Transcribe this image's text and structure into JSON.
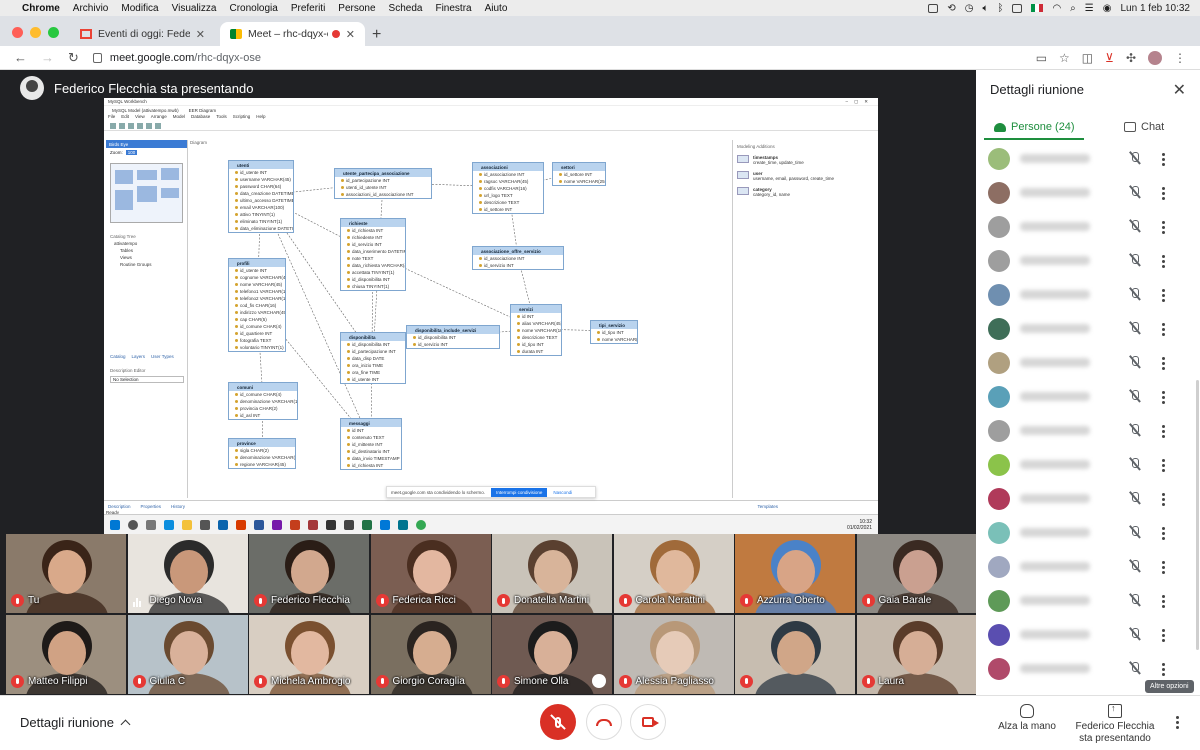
{
  "macos_menu": {
    "app": "Chrome",
    "items": [
      "Archivio",
      "Modifica",
      "Visualizza",
      "Cronologia",
      "Preferiti",
      "Persone",
      "Scheda",
      "Finestra",
      "Aiuto"
    ],
    "clock": "Lun 1 feb  10:32"
  },
  "browser": {
    "tabs": [
      {
        "title": "Eventi di oggi: Federico Flecchia"
      },
      {
        "title": "Meet – rhc-dqyx-ose"
      }
    ],
    "url_host": "meet.google.com",
    "url_path": "/rhc-dqyx-ose"
  },
  "stage": {
    "presenter_label": "Federico Flecchia sta presentando"
  },
  "workbench": {
    "title": "MySQL Workbench",
    "tabs": [
      "MySQL Model (attivatempo.mwb)",
      "EER Diagram"
    ],
    "menu": [
      "File",
      "Edit",
      "View",
      "Arrange",
      "Model",
      "Database",
      "Tools",
      "Scripting",
      "Help"
    ],
    "left_head": "Birds Eye",
    "zoom_label": "Zoom:",
    "zoom_value": "100",
    "catalog_label": "Catalog Tree",
    "tree": [
      "attivatempo",
      "Tables",
      "Views",
      "Routine Groups"
    ],
    "left_tabs": [
      "Catalog",
      "Layers",
      "User Types"
    ],
    "description_label": "Description Editor",
    "no_selection": "No Selection",
    "canvas_label": "Diagram",
    "right_head": "Modeling Additions",
    "additions": [
      {
        "name": "timestamps",
        "desc": "create_time, update_time"
      },
      {
        "name": "user",
        "desc": "username, email, password, create_time"
      },
      {
        "name": "category",
        "desc": "category_id, name"
      }
    ],
    "bottom_tabs": [
      "Description",
      "Properties",
      "History"
    ],
    "right_bottom_tab": "Templates",
    "status": "Ready",
    "taskbar_time": "10:32",
    "taskbar_date": "01/02/2021",
    "share_msg": "meet.google.com sta condividendo lo schermo.",
    "share_stop": "Interrompi condivisione",
    "share_hide": "Nascondi",
    "entities": [
      {
        "name": "utenti",
        "fields": [
          "id_utente INT",
          "username VARCHAR(45)",
          "password CHAR(64)",
          "data_creazione DATETIME",
          "ultimo_accesso DATETIME",
          "email VARCHAR(100)",
          "attivo TINYINT(1)",
          "eliminato TINYINT(1)",
          "data_eliminazione DATETIME"
        ]
      },
      {
        "name": "profili",
        "fields": [
          "id_utente INT",
          "cognome VARCHAR(45)",
          "nome VARCHAR(45)",
          "telefono1 VARCHAR(15)",
          "telefono2 VARCHAR(15)",
          "cod_fis CHAR(16)",
          "indirizzo VARCHAR(45)",
          "cap CHAR(5)",
          "id_comune CHAR(4)",
          "id_quartiere INT",
          "fotografia TEXT",
          "volontario TINYINT(1)"
        ]
      },
      {
        "name": "comuni",
        "fields": [
          "id_comune CHAR(4)",
          "denominazione VARCHAR(100)",
          "provincia CHAR(2)",
          "id_asl INT"
        ]
      },
      {
        "name": "province",
        "fields": [
          "sigla CHAR(2)",
          "denominazione VARCHAR(45)",
          "regione VARCHAR(45)"
        ]
      },
      {
        "name": "utente_partecipa_associazione",
        "fields": [
          "id_partecipazione INT",
          "utenti_id_utente INT",
          "associazioni_id_associazione INT"
        ]
      },
      {
        "name": "richieste",
        "fields": [
          "id_richiesta INT",
          "richiedente INT",
          "id_servizio INT",
          "data_inserimento DATETIME",
          "note TEXT",
          "data_richiesta VARCHAR(45)",
          "accettata TINYINT(1)",
          "id_disponibilita INT",
          "chiusa TINYINT(1)"
        ]
      },
      {
        "name": "disponibilita",
        "fields": [
          "id_disponibilita INT",
          "id_partecipazione INT",
          "data_disp DATE",
          "ora_inizio TIME",
          "ora_fine TIME",
          "id_utente INT"
        ]
      },
      {
        "name": "messaggi",
        "fields": [
          "id INT",
          "contenuto TEXT",
          "id_mittente INT",
          "id_destinatario INT",
          "data_invio TIMESTAMP",
          "id_richiesta INT"
        ]
      },
      {
        "name": "disponibilita_include_servizi",
        "fields": [
          "id_disponibilita INT",
          "id_servizio INT"
        ]
      },
      {
        "name": "associazioni",
        "fields": [
          "id_associazione INT",
          "ragsoc VARCHAR(45)",
          "codfis VARCHAR(16)",
          "url_logo TEXT",
          "descrizione TEXT",
          "id_settore INT"
        ]
      },
      {
        "name": "settori",
        "fields": [
          "id_settore INT",
          "nome VARCHAR(255)"
        ]
      },
      {
        "name": "associazione_offre_servizio",
        "fields": [
          "id_associazione INT",
          "id_servizio INT"
        ]
      },
      {
        "name": "servizi",
        "fields": [
          "id INT",
          "alias VARCHAR(45)",
          "nome VARCHAR(100)",
          "descrizione TEXT",
          "id_tipo INT",
          "durata INT"
        ]
      },
      {
        "name": "tipi_servizio",
        "fields": [
          "id_tipo INT",
          "nome VARCHAR(45)"
        ]
      }
    ]
  },
  "participants": [
    {
      "name": "Tu",
      "bg": "#8a7a6a",
      "face": "#d9a98a",
      "hair": "#3a2418"
    },
    {
      "name": "Diego Nova",
      "bg": "#e8e4de",
      "face": "#c9987a",
      "hair": "#2b2b2b"
    },
    {
      "name": "Federico Flecchia",
      "bg": "#6b6d68",
      "face": "#d2a88e",
      "hair": "#2a1d16"
    },
    {
      "name": "Federica Ricci",
      "bg": "#7b5e52",
      "face": "#e3b7a0",
      "hair": "#4a2e20"
    },
    {
      "name": "Donatella Martini",
      "bg": "#c9c3b9",
      "face": "#d8b49a",
      "hair": "#5a4030"
    },
    {
      "name": "Carola Nerattini",
      "bg": "#d5cfc6",
      "face": "#e0b89c",
      "hair": "#a06a3a"
    },
    {
      "name": "Azzurra Oberto",
      "bg": "#c07a40",
      "face": "#d8a486",
      "hair": "#4a82c8"
    },
    {
      "name": "Gaia Barale",
      "bg": "#8e8a84",
      "face": "#caa090",
      "hair": "#3a2a22"
    },
    {
      "name": "Matteo Filippi",
      "bg": "#9c8f7f",
      "face": "#d0a284",
      "hair": "#1e1a18"
    },
    {
      "name": "Giulia C",
      "bg": "#b7c2c9",
      "face": "#d9b19a",
      "hair": "#6a4a30"
    },
    {
      "name": "Michela Ambrogio",
      "bg": "#d8cec2",
      "face": "#e2b8a0",
      "hair": "#7a5030"
    },
    {
      "name": "Giorgio Coraglia",
      "bg": "#7a6f60",
      "face": "#d6ad90",
      "hair": "#2a2420"
    },
    {
      "name": "Simone Olla",
      "bg": "#6f5a52",
      "face": "#d8b098",
      "hair": "#1c1c1c"
    },
    {
      "name": "Alessia Pagliasso",
      "bg": "#bfbab4",
      "face": "#e6cbb8",
      "hair": "#b89878"
    },
    {
      "name": "",
      "bg": "#c7bdb0",
      "face": "#d0a688",
      "hair": "#2e3a44"
    },
    {
      "name": "Laura",
      "bg": "#c5b9ac",
      "face": "#d6ae96",
      "hair": "#5a3c2a"
    }
  ],
  "panel": {
    "title": "Dettagli riunione",
    "people_tab": "Persone (24)",
    "chat_tab": "Chat",
    "avatars": [
      "#9bbd7a",
      "#8d6e63",
      "#9e9e9e",
      "#9e9e9e",
      "#6f8fb0",
      "#3f6e58",
      "#b0a080",
      "#5aa0b8",
      "#9e9e9e",
      "#8bc34a",
      "#b03a5a",
      "#7ac0b8",
      "#a0a8c0",
      "#5e9a58",
      "#5a4eb0",
      "#b04a6a"
    ]
  },
  "controls": {
    "meeting_details": "Dettagli riunione",
    "raise_hand": "Alza la mano",
    "present_line1": "Federico Flecchia",
    "present_line2": "sta presentando",
    "tooltip": "Altre opzioni"
  },
  "colors": {
    "meet_green": "#1e8e3e",
    "mute_red": "#d93025",
    "stage_bg": "#202124"
  }
}
